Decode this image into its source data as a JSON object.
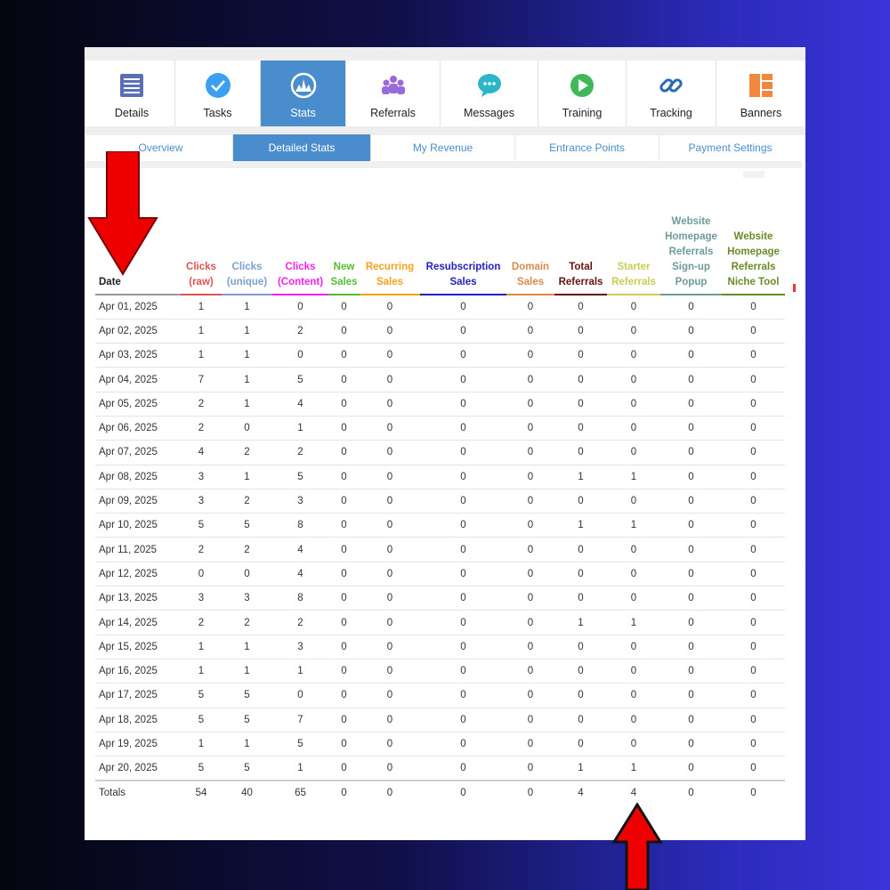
{
  "nav": [
    {
      "label": "Details",
      "icon": "list-icon",
      "active": false
    },
    {
      "label": "Tasks",
      "icon": "check-circle-icon",
      "active": false
    },
    {
      "label": "Stats",
      "icon": "chart-circle-icon",
      "active": true
    },
    {
      "label": "Referrals",
      "icon": "people-icon",
      "active": false
    },
    {
      "label": "Messages",
      "icon": "chat-bubble-icon",
      "active": false
    },
    {
      "label": "Training",
      "icon": "play-circle-icon",
      "active": false
    },
    {
      "label": "Tracking",
      "icon": "link-icon",
      "active": false
    },
    {
      "label": "Banners",
      "icon": "banners-icon",
      "active": false
    }
  ],
  "subnav": [
    {
      "label": "Overview",
      "active": false
    },
    {
      "label": "Detailed Stats",
      "active": true
    },
    {
      "label": "My Revenue",
      "active": false
    },
    {
      "label": "Entrance Points",
      "active": false
    },
    {
      "label": "Payment Settings",
      "active": false
    }
  ],
  "table": {
    "date_header": "Date",
    "columns": [
      {
        "lines": [
          "Clicks",
          "(raw)"
        ],
        "color": "#e05252"
      },
      {
        "lines": [
          "Clicks",
          "(unique)"
        ],
        "color": "#7d9fd0"
      },
      {
        "lines": [
          "Clicks",
          "(Content)"
        ],
        "color": "#ee22ee"
      },
      {
        "lines": [
          "New",
          "Sales"
        ],
        "color": "#55bb33"
      },
      {
        "lines": [
          "Recurring",
          "Sales"
        ],
        "color": "#f4a21a"
      },
      {
        "lines": [
          "Resubscription",
          "Sales"
        ],
        "color": "#2222bb"
      },
      {
        "lines": [
          "Domain",
          "Sales"
        ],
        "color": "#d98a4a"
      },
      {
        "lines": [
          "Total",
          "Referrals"
        ],
        "color": "#661111"
      },
      {
        "lines": [
          "Starter",
          "Referrals"
        ],
        "color": "#c9cc55"
      },
      {
        "lines": [
          "Website",
          "Homepage",
          "Referrals",
          "Sign-up",
          "Popup"
        ],
        "color": "#6e9a9a"
      },
      {
        "lines": [
          "Website",
          "Homepage",
          "Referrals",
          "Niche Tool"
        ],
        "color": "#6a8a2a"
      }
    ],
    "rows": [
      {
        "date": "Apr 01, 2025",
        "values": [
          1,
          1,
          0,
          0,
          0,
          0,
          0,
          0,
          0,
          0,
          0
        ]
      },
      {
        "date": "Apr 02, 2025",
        "values": [
          1,
          1,
          2,
          0,
          0,
          0,
          0,
          0,
          0,
          0,
          0
        ]
      },
      {
        "date": "Apr 03, 2025",
        "values": [
          1,
          1,
          0,
          0,
          0,
          0,
          0,
          0,
          0,
          0,
          0
        ]
      },
      {
        "date": "Apr 04, 2025",
        "values": [
          7,
          1,
          5,
          0,
          0,
          0,
          0,
          0,
          0,
          0,
          0
        ]
      },
      {
        "date": "Apr 05, 2025",
        "values": [
          2,
          1,
          4,
          0,
          0,
          0,
          0,
          0,
          0,
          0,
          0
        ]
      },
      {
        "date": "Apr 06, 2025",
        "values": [
          2,
          0,
          1,
          0,
          0,
          0,
          0,
          0,
          0,
          0,
          0
        ]
      },
      {
        "date": "Apr 07, 2025",
        "values": [
          4,
          2,
          2,
          0,
          0,
          0,
          0,
          0,
          0,
          0,
          0
        ]
      },
      {
        "date": "Apr 08, 2025",
        "values": [
          3,
          1,
          5,
          0,
          0,
          0,
          0,
          1,
          1,
          0,
          0
        ]
      },
      {
        "date": "Apr 09, 2025",
        "values": [
          3,
          2,
          3,
          0,
          0,
          0,
          0,
          0,
          0,
          0,
          0
        ]
      },
      {
        "date": "Apr 10, 2025",
        "values": [
          5,
          5,
          8,
          0,
          0,
          0,
          0,
          1,
          1,
          0,
          0
        ]
      },
      {
        "date": "Apr 11, 2025",
        "values": [
          2,
          2,
          4,
          0,
          0,
          0,
          0,
          0,
          0,
          0,
          0
        ]
      },
      {
        "date": "Apr 12, 2025",
        "values": [
          0,
          0,
          4,
          0,
          0,
          0,
          0,
          0,
          0,
          0,
          0
        ]
      },
      {
        "date": "Apr 13, 2025",
        "values": [
          3,
          3,
          8,
          0,
          0,
          0,
          0,
          0,
          0,
          0,
          0
        ]
      },
      {
        "date": "Apr 14, 2025",
        "values": [
          2,
          2,
          2,
          0,
          0,
          0,
          0,
          1,
          1,
          0,
          0
        ]
      },
      {
        "date": "Apr 15, 2025",
        "values": [
          1,
          1,
          3,
          0,
          0,
          0,
          0,
          0,
          0,
          0,
          0
        ]
      },
      {
        "date": "Apr 16, 2025",
        "values": [
          1,
          1,
          1,
          0,
          0,
          0,
          0,
          0,
          0,
          0,
          0
        ]
      },
      {
        "date": "Apr 17, 2025",
        "values": [
          5,
          5,
          0,
          0,
          0,
          0,
          0,
          0,
          0,
          0,
          0
        ]
      },
      {
        "date": "Apr 18, 2025",
        "values": [
          5,
          5,
          7,
          0,
          0,
          0,
          0,
          0,
          0,
          0,
          0
        ]
      },
      {
        "date": "Apr 19, 2025",
        "values": [
          1,
          1,
          5,
          0,
          0,
          0,
          0,
          0,
          0,
          0,
          0
        ]
      },
      {
        "date": "Apr 20, 2025",
        "values": [
          5,
          5,
          1,
          0,
          0,
          0,
          0,
          1,
          1,
          0,
          0
        ]
      }
    ],
    "totals": {
      "label": "Totals",
      "values": [
        54,
        40,
        65,
        0,
        0,
        0,
        0,
        4,
        4,
        0,
        0
      ]
    }
  },
  "colors": {
    "accent": "#4a8dcc",
    "arrow": "#ee0000"
  }
}
